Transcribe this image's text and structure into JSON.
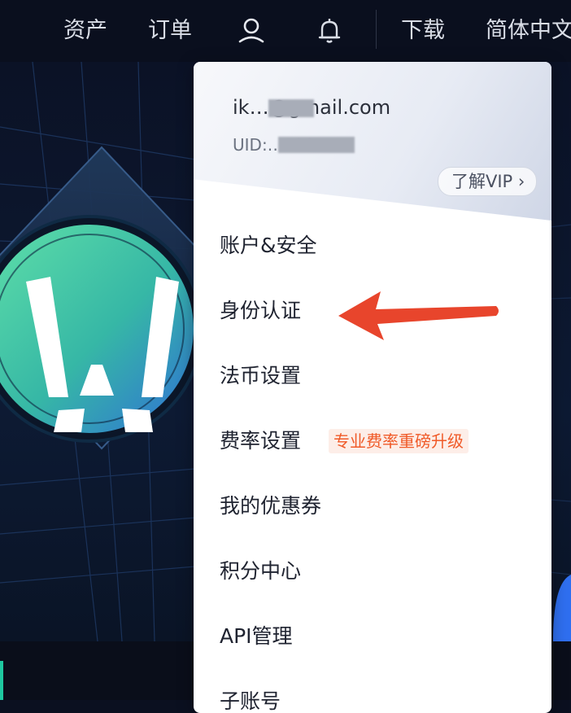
{
  "nav": {
    "assets": "资产",
    "orders": "订单",
    "user_icon": "user-icon",
    "bell_icon": "bell-icon",
    "download": "下载",
    "language": "简体中文"
  },
  "account": {
    "email": "ik…@gmail.com",
    "uid": "UID:…100",
    "vip_button": "了解VIP ›"
  },
  "menu": {
    "items": [
      {
        "label": "账户&安全"
      },
      {
        "label": "身份认证"
      },
      {
        "label": "法币设置"
      },
      {
        "label": "费率设置",
        "badge": "专业费率重磅升级"
      },
      {
        "label": "我的优惠券"
      },
      {
        "label": "积分中心"
      },
      {
        "label": "API管理"
      },
      {
        "label": "子账号"
      }
    ]
  },
  "colors": {
    "arrow": "#e8452c",
    "promo_text": "#f05a28",
    "brand_green": "#1ec8a0"
  }
}
